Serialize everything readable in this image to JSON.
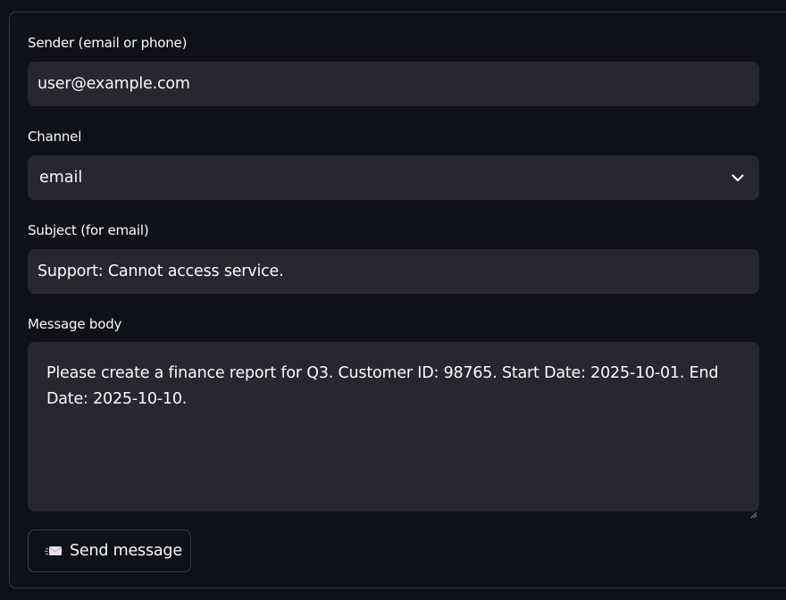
{
  "form": {
    "sender": {
      "label": "Sender (email or phone)",
      "value": "user@example.com"
    },
    "channel": {
      "label": "Channel",
      "value": "email",
      "icon": "chevron-down-icon"
    },
    "subject": {
      "label": "Subject (for email)",
      "value": "Support: Cannot access service."
    },
    "message": {
      "label": "Message body",
      "value": "Please create a finance report for Q3. Customer ID: 98765. Start Date: 2025-10-01. End Date: 2025-10-10."
    },
    "send_button": {
      "label": "Send message",
      "icon": "envelope-icon"
    }
  },
  "colors": {
    "background": "#0e1117",
    "input_background": "#262730",
    "border": "#31333f",
    "text": "#fafafa"
  }
}
